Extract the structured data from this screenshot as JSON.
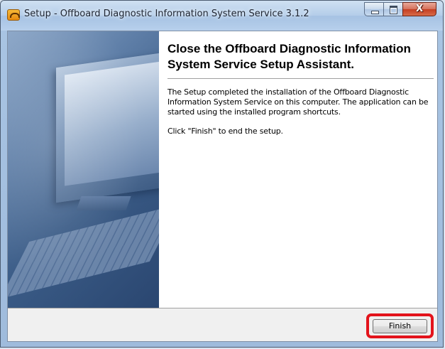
{
  "window": {
    "title": "Setup - Offboard Diagnostic Information System Service 3.1.2",
    "icon": "setup-wizard-icon"
  },
  "caption_buttons": {
    "minimize": "minimize-icon",
    "maximize": "maximize-icon",
    "close_glyph": "X"
  },
  "page": {
    "heading": "Close the Offboard Diagnostic Information System Service Setup Assistant.",
    "paragraphs": [
      "The Setup completed the installation of the Offboard Diagnostic Information System Service on this computer. The application can be started using the installed program shortcuts.",
      "Click \"Finish\" to end the setup."
    ]
  },
  "footer": {
    "finish_label": "Finish",
    "highlight_color": "#e3131b"
  }
}
